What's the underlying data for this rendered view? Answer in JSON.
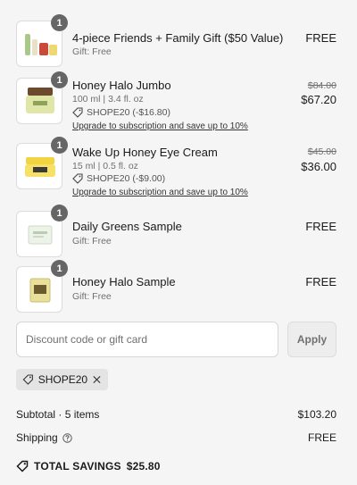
{
  "items": [
    {
      "qty": "1",
      "name": "4-piece Friends + Family Gift ($50 Value)",
      "sub": "Gift: Free",
      "price": "FREE"
    },
    {
      "qty": "1",
      "name": "Honey Halo Jumbo",
      "sub": "100 ml | 3.4 fl. oz",
      "discount": "SHOPE20 (-$16.80)",
      "upgrade": "Upgrade to subscription and save up to 10%",
      "original_price": "$84.00",
      "price": "$67.20"
    },
    {
      "qty": "1",
      "name": "Wake Up Honey Eye Cream",
      "sub": "15 ml | 0.5 fl. oz",
      "discount": "SHOPE20 (-$9.00)",
      "upgrade": "Upgrade to subscription and save up to 10%",
      "original_price": "$45.00",
      "price": "$36.00"
    },
    {
      "qty": "1",
      "name": "Daily Greens Sample",
      "sub": "Gift: Free",
      "price": "FREE"
    },
    {
      "qty": "1",
      "name": "Honey Halo Sample",
      "sub": "Gift: Free",
      "price": "FREE"
    }
  ],
  "discount_field": {
    "placeholder": "Discount code or gift card",
    "value": ""
  },
  "apply_label": "Apply",
  "applied_code": "SHOPE20",
  "summary": {
    "subtotal_label": "Subtotal · 5 items",
    "subtotal_value": "$103.20",
    "shipping_label": "Shipping",
    "shipping_value": "FREE",
    "total_savings_label": "TOTAL SAVINGS",
    "total_savings_value": "$25.80"
  },
  "colors": {
    "background": "#f5f5f5",
    "badge": "#666666",
    "text": "#1a1a1a",
    "muted": "#707070"
  }
}
